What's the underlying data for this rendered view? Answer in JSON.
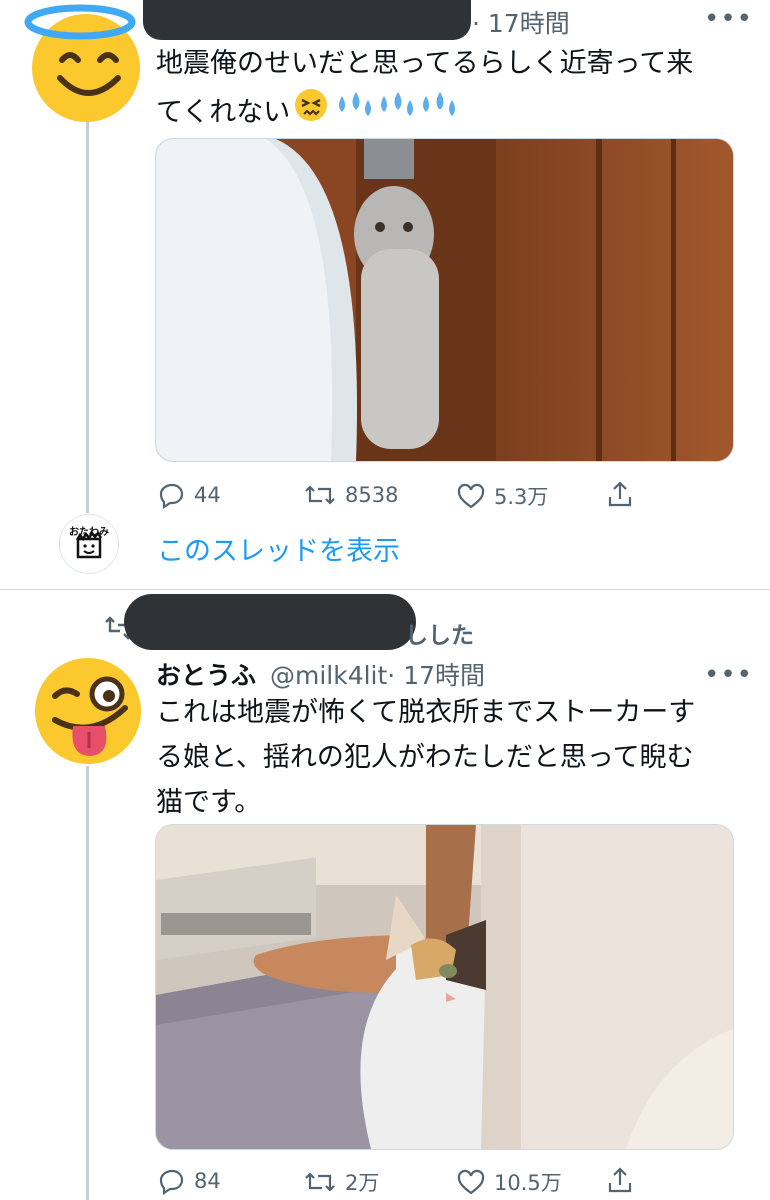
{
  "tweet1": {
    "time": "· 17時間",
    "text_line1": "地震俺のせいだと思ってるらしく近寄って来",
    "text_line2": "てくれない",
    "emoji_names": [
      "persevering-face-emoji",
      "sweat-droplets-emoji",
      "sweat-droplets-emoji",
      "sweat-droplets-emoji"
    ],
    "replies": "44",
    "retweets": "8538",
    "likes": "5.3万",
    "show_thread": "このスレッドを表示",
    "thread_avatar_text": "おたわみ"
  },
  "retweet_bar": {
    "suffix": "しした"
  },
  "tweet2": {
    "name": "おとうふ",
    "handle": "@milk4lit",
    "time": "· 17時間",
    "text_line1": "これは地震が怖くて脱衣所までストーカーす",
    "text_line2": "る娘と、揺れの犯人がわたしだと思って睨む",
    "text_line3": "猫です。",
    "replies": "84",
    "retweets": "2万",
    "likes": "10.5万"
  },
  "colors": {
    "accent": "#1d9bf0",
    "secondary_text": "#536471",
    "redaction": "#2f3336",
    "divider": "#cfd9de"
  }
}
